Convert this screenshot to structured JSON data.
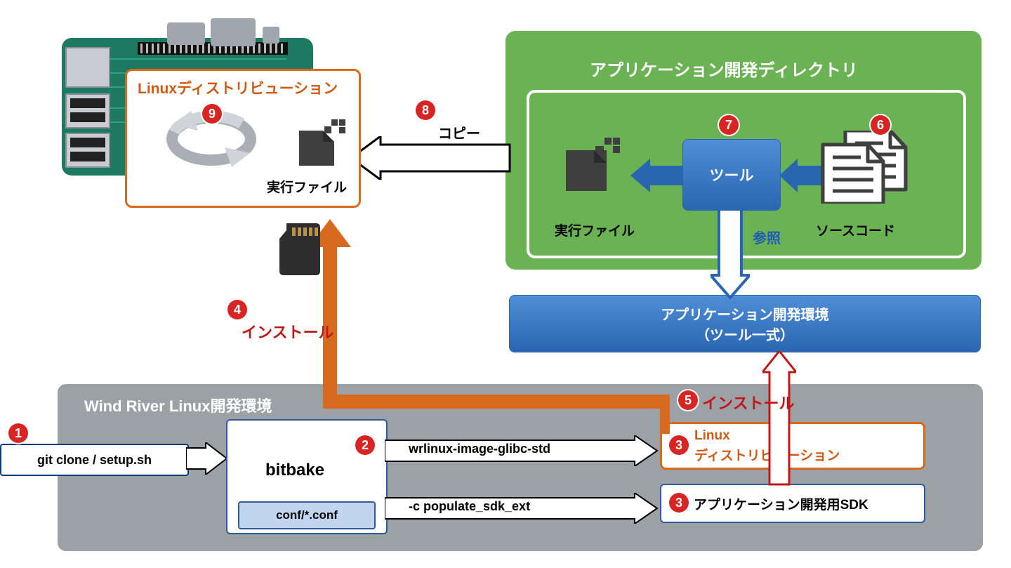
{
  "top_distro_title": "Linuxディストリビューション",
  "top_exec_label": "実行ファイル",
  "copy_label": "コピー",
  "appdev_dir_title": "アプリケーション開発ディレクトリ",
  "tool_label": "ツール",
  "ref_label": "参照",
  "exec_label_right": "実行ファイル",
  "src_label": "ソースコード",
  "appdev_env_line1": "アプリケーション開発環境",
  "appdev_env_line2": "（ツール一式）",
  "install_label_4": "インストール",
  "install_label_5": "インストール",
  "windriver_title": "Wind River Linux開発環境",
  "git_clone_label": "git clone / setup.sh",
  "bitbake_label": "bitbake",
  "conf_label": "conf/*.conf",
  "bitbake_out1": "wrlinux-image-glibc-std",
  "bitbake_out2": "-c populate_sdk_ext",
  "out_distro_line1": "Linux",
  "out_distro_line2": "ディストリビューション",
  "out_sdk_label": "アプリケーション開発用SDK",
  "badges": {
    "b1": "1",
    "b2": "2",
    "b3": "3",
    "b4": "4",
    "b5": "5",
    "b6": "6",
    "b7": "7",
    "b8": "8",
    "b9": "9"
  }
}
